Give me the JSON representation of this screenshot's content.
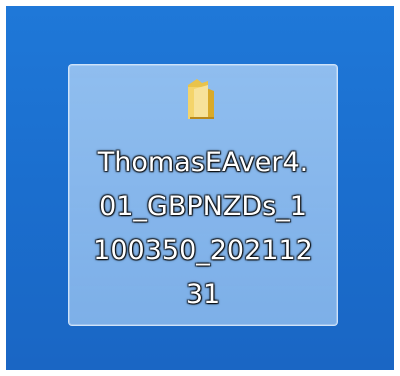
{
  "desktop": {
    "background_color": "#1c6fd0",
    "icon": {
      "type_icon": "folder-icon",
      "selected": true,
      "label_lines": [
        "ThomasEAver4.",
        "01_GBPNZDs_1",
        "100350_202112",
        "31"
      ]
    }
  }
}
